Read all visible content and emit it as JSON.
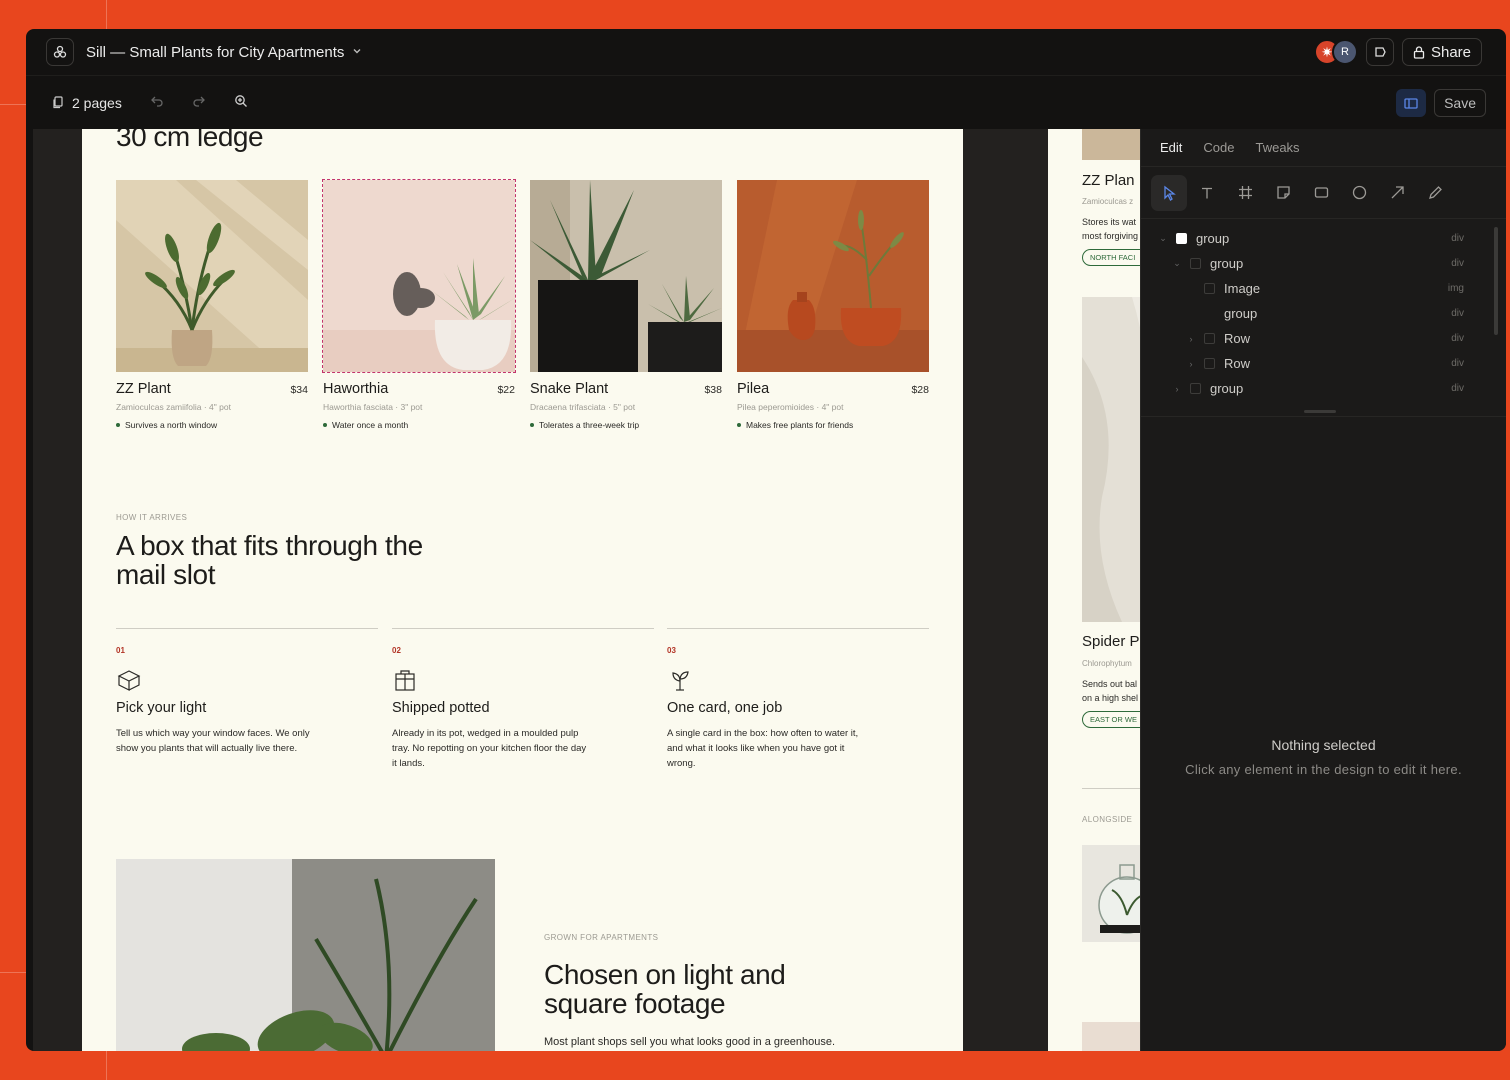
{
  "window": {
    "title": "Sill — Small Plants for City Apartments",
    "share_label": "Share",
    "avatar_initial": "R"
  },
  "toolbar": {
    "pages_label": "2 pages",
    "save_label": "Save"
  },
  "page": {
    "ledge_heading": "30 cm ledge",
    "products": [
      {
        "name": "ZZ Plant",
        "price": "$34",
        "sub": "Zamioculcas zamiifolia · 4\" pot",
        "feature": "Survives a north window"
      },
      {
        "name": "Haworthia",
        "price": "$22",
        "sub": "Haworthia fasciata · 3\" pot",
        "feature": "Water once a month"
      },
      {
        "name": "Snake Plant",
        "price": "$38",
        "sub": "Dracaena trifasciata · 5\" pot",
        "feature": "Tolerates a three-week trip"
      },
      {
        "name": "Pilea",
        "price": "$28",
        "sub": "Pilea peperomioides · 4\" pot",
        "feature": "Makes free plants for friends"
      }
    ],
    "arrives": {
      "eyebrow": "HOW IT ARRIVES",
      "heading_line1": "A box that fits through the",
      "heading_line2": "mail slot",
      "steps": [
        {
          "num": "01",
          "title": "Pick your light",
          "body": "Tell us which way your window faces. We only show you plants that will actually live there.",
          "icon": "cube-icon"
        },
        {
          "num": "02",
          "title": "Shipped potted",
          "body": "Already in its pot, wedged in a moulded pulp tray. No repotting on your kitchen floor the day it lands.",
          "icon": "gift-box-icon"
        },
        {
          "num": "03",
          "title": "One card, one job",
          "body": "A single card in the box: how often to water it, and what it looks like when you have got it wrong.",
          "icon": "sprout-icon"
        }
      ]
    },
    "grown": {
      "eyebrow": "GROWN FOR APARTMENTS",
      "heading_line1": "Chosen on light and",
      "heading_line2": "square footage",
      "body": "Most plant shops sell you what looks good in a greenhouse."
    }
  },
  "page2": {
    "title1": "ZZ Plan",
    "sub1": "Zamioculcas z",
    "body1a": "Stores its wat",
    "body1b": "most forgiving",
    "tag1": "NORTH FACI",
    "title2": "Spider P",
    "sub2": "Chlorophytum",
    "body2a": "Sends out bal",
    "body2b": "on a high shel",
    "tag2": "EAST OR WE",
    "eyebrow": "ALONGSIDE"
  },
  "panel": {
    "tabs": [
      "Edit",
      "Code",
      "Tweaks"
    ],
    "layers": [
      {
        "label": "group",
        "tag": "div",
        "indent": 0,
        "caret": "⌄",
        "white": true
      },
      {
        "label": "group",
        "tag": "div",
        "indent": 1,
        "caret": "⌄",
        "white": false
      },
      {
        "label": "Image",
        "tag": "img",
        "indent": 2,
        "caret": "",
        "white": false
      },
      {
        "label": "group",
        "tag": "div",
        "indent": 2,
        "caret": "",
        "white": false
      },
      {
        "label": "Row",
        "tag": "div",
        "indent": 2,
        "caret": "›",
        "white": false
      },
      {
        "label": "Row",
        "tag": "div",
        "indent": 2,
        "caret": "›",
        "white": false
      },
      {
        "label": "group",
        "tag": "div",
        "indent": 1,
        "caret": "›",
        "white": false
      }
    ],
    "empty_title": "Nothing selected",
    "empty_body": "Click any element in the design to edit it here."
  }
}
